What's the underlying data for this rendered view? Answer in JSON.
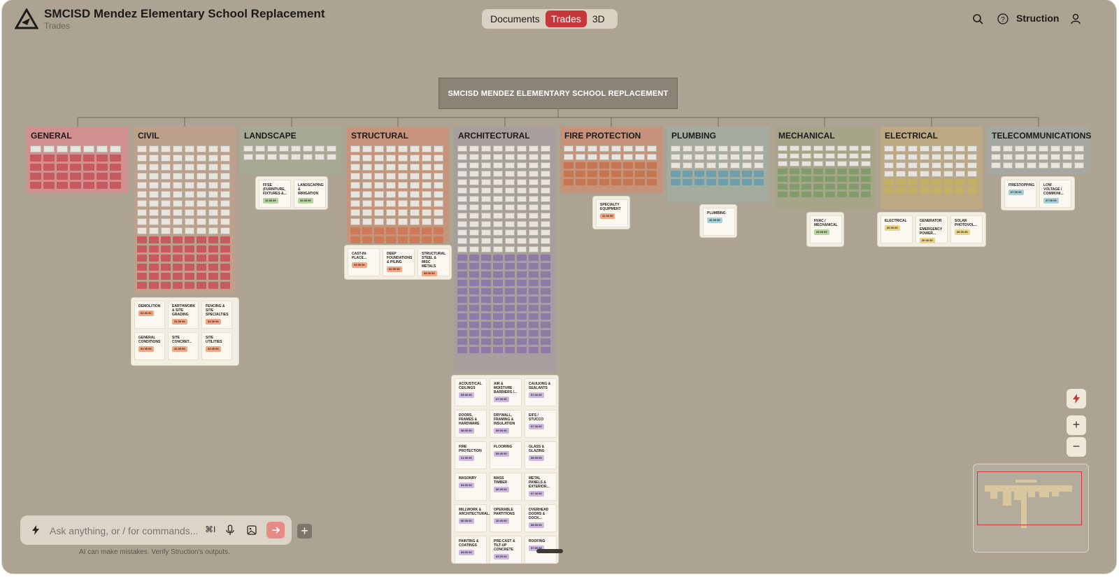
{
  "header": {
    "title": "SMCISD Mendez Elementary School Replacement",
    "subtitle": "Trades",
    "tabs": [
      {
        "label": "Documents",
        "active": false
      },
      {
        "label": "Trades",
        "active": true
      },
      {
        "label": "3D",
        "active": false
      }
    ],
    "user_label": "Struction"
  },
  "root_node": {
    "label": "SMCISD MENDEZ ELEMENTARY SCHOOL REPLACEMENT"
  },
  "trades": [
    {
      "name": "GENERAL",
      "color": "#d19090",
      "chip_color": "#c65a5e"
    },
    {
      "name": "CIVIL",
      "color": "#bca08c",
      "chip_color": "#c9835e"
    },
    {
      "name": "LANDSCAPE",
      "color": "#a6aa94",
      "chip_color": "#9fb07e"
    },
    {
      "name": "STRUCTURAL",
      "color": "#c6947a",
      "chip_color": "#cc7a58"
    },
    {
      "name": "ARCHITECTURAL",
      "color": "#a89e9d",
      "chip_color": "#8e7aa3"
    },
    {
      "name": "FIRE PROTECTION",
      "color": "#c6937a",
      "chip_color": "#c47652"
    },
    {
      "name": "PLUMBING",
      "color": "#a4aca0",
      "chip_color": "#6f9ea8"
    },
    {
      "name": "MECHANICAL",
      "color": "#a6a58a",
      "chip_color": "#7f9c6a"
    },
    {
      "name": "ELECTRICAL",
      "color": "#bca984",
      "chip_color": "#c2b069"
    },
    {
      "name": "TELECOMMUNICATIONS",
      "color": "#a4a8a0",
      "chip_color": "#7fa4ae"
    }
  ],
  "cards": {
    "landscape": [
      {
        "label": "FFSE (FURNITURE, FIXTURES &...",
        "tag": "12 00 00",
        "tag_color": "#b6d2a0"
      },
      {
        "label": "LANDSCAPING & IRRIGATION",
        "tag": "32 00 00",
        "tag_color": "#b6d2a0"
      }
    ],
    "civil": [
      {
        "label": "DEMOLITION",
        "tag": "02 00 00",
        "tag_color": "#f1a686"
      },
      {
        "label": "EARTHWORK & SITE GRADING",
        "tag": "31 00 00",
        "tag_color": "#f1a686"
      },
      {
        "label": "FENCING & SITE SPECIALTIES",
        "tag": "32 00 00",
        "tag_color": "#f1a686"
      },
      {
        "label": "GENERAL CONDITIONS",
        "tag": "01 00 00",
        "tag_color": "#f1a686"
      },
      {
        "label": "SITE CONCRET...",
        "tag": "32 00 00",
        "tag_color": "#f1a686"
      },
      {
        "label": "SITE UTILITIES",
        "tag": "33 00 00",
        "tag_color": "#f1a686"
      }
    ],
    "structural": [
      {
        "label": "CAST-IN-PLACE...",
        "tag": "03 00 00",
        "tag_color": "#f1a686"
      },
      {
        "label": "DEEP FOUNDATIONS & PILING",
        "tag": "31 00 00",
        "tag_color": "#f1a686"
      },
      {
        "label": "STRUCTURAL STEEL & MISC METALS",
        "tag": "05 00 00",
        "tag_color": "#f1a686"
      }
    ],
    "fire": [
      {
        "label": "SPECIALTY EQUIPMENT",
        "tag": "11 00 00",
        "tag_color": "#f1a686"
      }
    ],
    "plumbing": [
      {
        "label": "PLUMBING",
        "tag": "22 00 00",
        "tag_color": "#a9d0d6"
      }
    ],
    "mechanical": [
      {
        "label": "HVAC / MECHANICAL",
        "tag": "23 00 00",
        "tag_color": "#b6d2a0"
      }
    ],
    "electrical": [
      {
        "label": "ELECTRICAL",
        "tag": "26 00 00",
        "tag_color": "#e9d48a"
      },
      {
        "label": "GENERATOR / EMERGENCY POWER...",
        "tag": "26 00 00",
        "tag_color": "#e9d48a"
      },
      {
        "label": "SOLAR PHOTOVOL...",
        "tag": "26 00 00",
        "tag_color": "#e9d48a"
      }
    ],
    "telecom": [
      {
        "label": "FIRESTOPPING",
        "tag": "07 00 00",
        "tag_color": "#a9d0d6"
      },
      {
        "label": "LOW VOLTAGE / COMMUNI...",
        "tag": "27 00 00",
        "tag_color": "#a9d0d6"
      }
    ],
    "architectural": [
      {
        "label": "ACOUSTICAL CEILINGS",
        "tag": "09 00 00",
        "tag_color": "#cdb8e0"
      },
      {
        "label": "AIR & MOISTURE BARRIERS /...",
        "tag": "07 00 00",
        "tag_color": "#cdb8e0"
      },
      {
        "label": "CAULKING & SEALANTS",
        "tag": "07 00 00",
        "tag_color": "#cdb8e0"
      },
      {
        "label": "DOORS, FRAMES & HARDWARE",
        "tag": "08 00 00",
        "tag_color": "#cdb8e0"
      },
      {
        "label": "DRYWALL, FRAMING & INSULATION",
        "tag": "09 00 00",
        "tag_color": "#cdb8e0"
      },
      {
        "label": "EIFS / STUCCO",
        "tag": "07 00 00",
        "tag_color": "#cdb8e0"
      },
      {
        "label": "FIRE PROTECTION",
        "tag": "21 00 00",
        "tag_color": "#cdb8e0"
      },
      {
        "label": "FLOORING",
        "tag": "09 00 00",
        "tag_color": "#cdb8e0"
      },
      {
        "label": "GLASS & GLAZING",
        "tag": "08 00 00",
        "tag_color": "#cdb8e0"
      },
      {
        "label": "MASONRY",
        "tag": "04 00 00",
        "tag_color": "#cdb8e0"
      },
      {
        "label": "MASS TIMBER",
        "tag": "06 00 00",
        "tag_color": "#cdb8e0"
      },
      {
        "label": "METAL PANELS & EXTERIOR...",
        "tag": "07 00 00",
        "tag_color": "#cdb8e0"
      },
      {
        "label": "MILLWORK & ARCHITECTURAL...",
        "tag": "06 00 00",
        "tag_color": "#cdb8e0"
      },
      {
        "label": "OPERABLE PARTITIONS",
        "tag": "10 00 00",
        "tag_color": "#cdb8e0"
      },
      {
        "label": "OVERHEAD DOORS & DOCK...",
        "tag": "08 00 00",
        "tag_color": "#cdb8e0"
      },
      {
        "label": "PAINTING & COATINGS",
        "tag": "09 00 00",
        "tag_color": "#cdb8e0"
      },
      {
        "label": "PRE-CAST & TILT-UP CONCRETE",
        "tag": "03 00 00",
        "tag_color": "#cdb8e0"
      },
      {
        "label": "ROOFING",
        "tag": "07 00 00",
        "tag_color": "#cdb8e0"
      }
    ]
  },
  "chat": {
    "placeholder": "Ask anything, or / for commands...",
    "shortcut": "⌘I",
    "disclaimer": "AI can make mistakes. Verify Struction's outputs."
  },
  "zoom": {
    "plus": "+",
    "minus": "−"
  },
  "icons": {
    "logo": "struction-logo-icon",
    "search": "search-icon",
    "help": "help-icon",
    "user": "user-icon",
    "ai": "lightning-icon",
    "mic": "microphone-icon",
    "image": "image-icon",
    "send": "arrow-right-icon",
    "add": "plus-icon"
  }
}
